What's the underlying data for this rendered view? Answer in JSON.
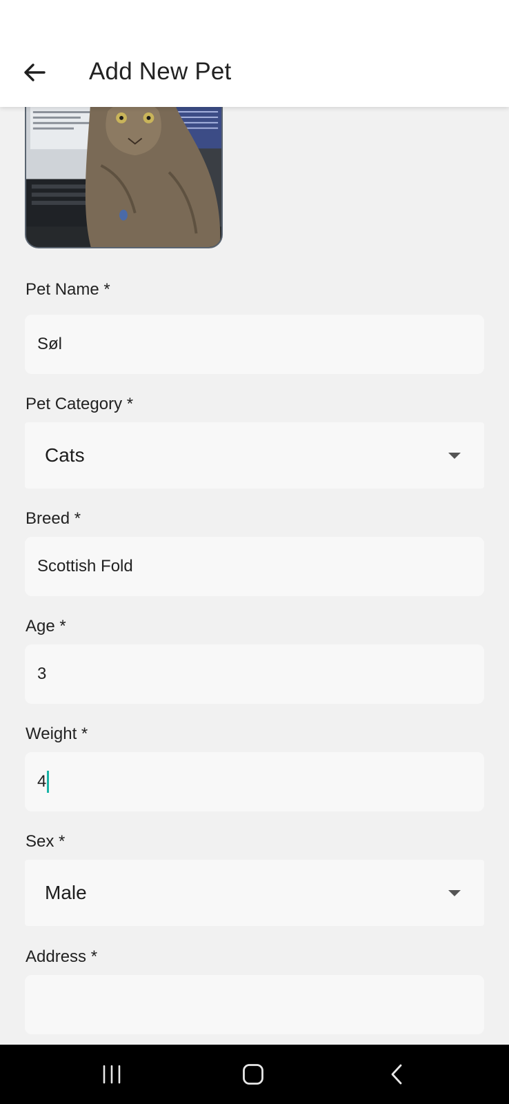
{
  "header": {
    "title": "Add New Pet"
  },
  "fields": {
    "pet_name": {
      "label": "Pet Name *",
      "value": "Søl"
    },
    "pet_category": {
      "label": "Pet Category *",
      "value": "Cats"
    },
    "breed": {
      "label": "Breed *",
      "value": "Scottish Fold"
    },
    "age": {
      "label": "Age *",
      "value": "3"
    },
    "weight": {
      "label": "Weight *",
      "value": "4"
    },
    "sex": {
      "label": "Sex *",
      "value": "Male"
    },
    "address": {
      "label": "Address *",
      "value": ""
    }
  },
  "colors": {
    "background": "#f1f1f1",
    "field_background": "#f8f8f8",
    "cursor": "#18b3a6",
    "nav_bar": "#000000"
  },
  "icons": {
    "back": "arrow-left-icon",
    "dropdown": "caret-down-icon",
    "nav_recents": "recents-icon",
    "nav_home": "home-icon",
    "nav_back": "chevron-left-icon"
  }
}
